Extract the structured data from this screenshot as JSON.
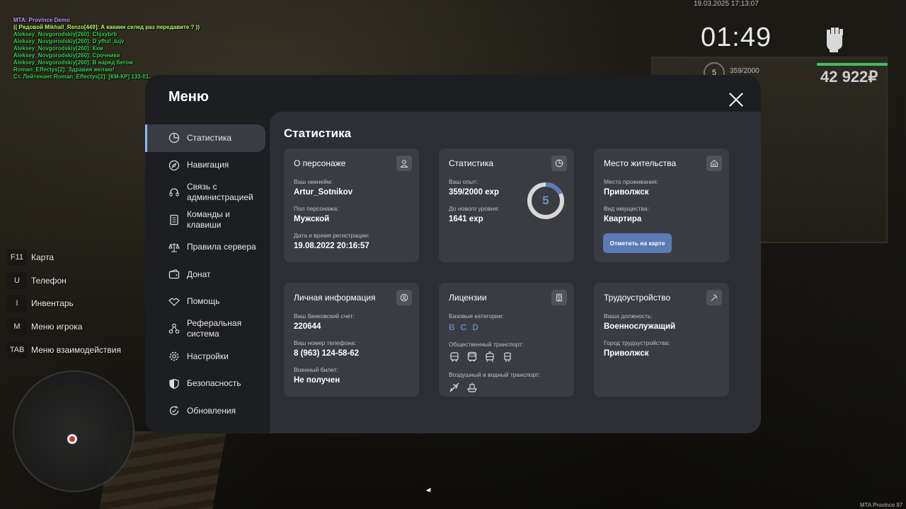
{
  "chat": [
    {
      "text": "MTA: Province Demo",
      "color": "#c79cff"
    },
    {
      "text": "(( Рядовой Mikhail_Renzo[449]: А какиин селед раз передавите ? ))",
      "color": "#b9ff6a"
    },
    {
      "text": "Aleksey_Novgorodskiy[260]: Chjxybrb",
      "color": "#39d24a"
    },
    {
      "text": "Aleksey_Novgorodskiy[260]: D yfhzl ,tujv",
      "color": "#39d24a"
    },
    {
      "text": "Aleksey_Novgorodskiy[260]: Кхм",
      "color": "#39d24a"
    },
    {
      "text": "Aleksey_Novgorodskiy[260]: Срочники",
      "color": "#39d24a"
    },
    {
      "text": "Aleksey_Novgorodskiy[260]: В наряд бегом",
      "color": "#39d24a"
    },
    {
      "text": "Roman_Effectys[2]: Здравия желаю!",
      "color": "#39d24a"
    },
    {
      "text": "Ст. Лейтенант Roman_Effectys[2]: [КМ-КР] 133-01.",
      "color": "#39d24a"
    }
  ],
  "hud": {
    "datetime": "19.03.2025 17:13:07",
    "clock": "01:49",
    "level": "5",
    "exp": "359/2000",
    "health": 1.0,
    "money": "42 922₽",
    "mta_label": "MTA Province 97"
  },
  "hotkeys": [
    {
      "key": "F11",
      "label": "Карта"
    },
    {
      "key": "U",
      "label": "Телефон"
    },
    {
      "key": "I",
      "label": "Инвентарь"
    },
    {
      "key": "M",
      "label": "Меню игрока"
    },
    {
      "key": "TAB",
      "label": "Меню взаимодействия"
    }
  ],
  "menu": {
    "title": "Меню",
    "nav": [
      {
        "label": "Статистика",
        "icon": "pie-chart-icon",
        "active": true
      },
      {
        "label": "Навигация",
        "icon": "compass-icon"
      },
      {
        "label": "Связь с администрацией",
        "icon": "headset-icon"
      },
      {
        "label": "Команды и клавиши",
        "icon": "document-icon"
      },
      {
        "label": "Правила сервера",
        "icon": "scales-icon"
      },
      {
        "label": "Донат",
        "icon": "wallet-icon"
      },
      {
        "label": "Помощь",
        "icon": "handshake-icon"
      },
      {
        "label": "Реферальная система",
        "icon": "network-icon"
      },
      {
        "label": "Настройки",
        "icon": "gear-icon"
      },
      {
        "label": "Безопасность",
        "icon": "shield-icon"
      },
      {
        "label": "Обновления",
        "icon": "refresh-icon"
      }
    ],
    "content_title": "Статистика",
    "cards": {
      "character": {
        "title": "О персонаже",
        "icon": "user-icon",
        "nickname_label": "Ваш никнейм:",
        "nickname": "Artur_Sotnikov",
        "gender_label": "Пол персонажа:",
        "gender": "Мужской",
        "reg_label": "Дата и время регистрации:",
        "reg": "19.08.2022 20:16:57"
      },
      "stats": {
        "title": "Статистика",
        "icon": "pie-chart-icon",
        "exp_label": "Ваш опыт:",
        "exp": "359/2000 exp",
        "next_label": "До нового уровня:",
        "next": "1641 exp",
        "level": "5",
        "progress": 0.1795,
        "accent": "#5b7bb4"
      },
      "residence": {
        "title": "Место жительства",
        "icon": "home-icon",
        "place_label": "Место проживания:",
        "place": "Приволжск",
        "property_label": "Вид имущества:",
        "property": "Квартира",
        "button": "Отметить на карте"
      },
      "personal": {
        "title": "Личная информация",
        "icon": "id-icon",
        "bank_label": "Ваш банковский счет:",
        "bank": "220644",
        "phone_label": "Ваш номер телефона:",
        "phone": "8 (963) 124-58-62",
        "military_label": "Военный билет:",
        "military": "Не получен"
      },
      "licenses": {
        "title": "Лицензии",
        "icon": "license-icon",
        "base_label": "Базовые категории:",
        "categories": [
          "B",
          "C",
          "D"
        ],
        "public_label": "Общественный транспорт:",
        "air_label": "Воздушный и водный транспорт:"
      },
      "employment": {
        "title": "Трудоустройство",
        "icon": "pickaxe-icon",
        "position_label": "Ваша должность:",
        "position": "Военнослужащий",
        "city_label": "Город трудоустройства:",
        "city": "Приволжск"
      }
    }
  }
}
